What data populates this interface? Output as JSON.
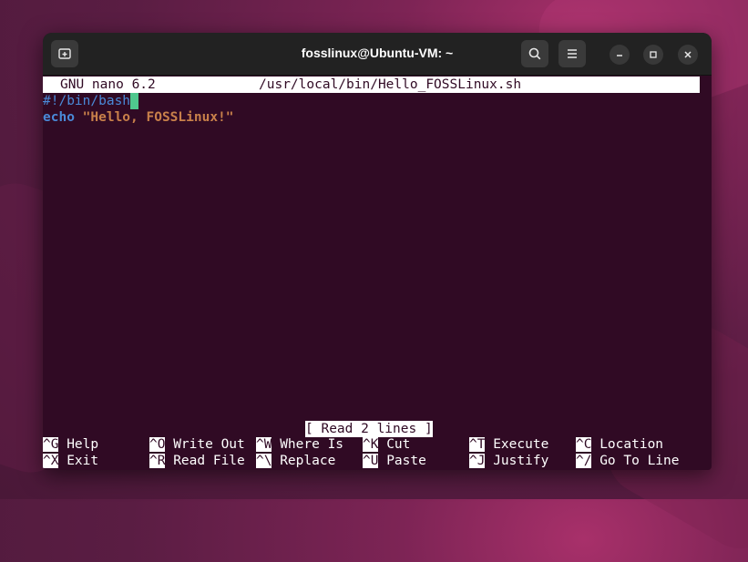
{
  "window": {
    "title": "fosslinux@Ubuntu-VM: ~",
    "buttons": {
      "new_tab_icon": "new-tab-icon",
      "search_icon": "search-icon",
      "menu_icon": "hamburger-menu-icon",
      "minimize_icon": "minimize-icon",
      "maximize_icon": "maximize-icon",
      "close_icon": "close-icon"
    }
  },
  "nano": {
    "version": "GNU nano 6.2",
    "filename": "/usr/local/bin/Hello_FOSSLinux.sh",
    "lines": {
      "shebang": "#!/bin/bash",
      "echo_keyword": "echo",
      "echo_string": "\"Hello, FOSSLinux!\""
    },
    "status": "[ Read 2 lines ]",
    "shortcuts_row1": [
      {
        "key": "^G",
        "label": "Help"
      },
      {
        "key": "^O",
        "label": "Write Out"
      },
      {
        "key": "^W",
        "label": "Where Is"
      },
      {
        "key": "^K",
        "label": "Cut"
      },
      {
        "key": "^T",
        "label": "Execute"
      },
      {
        "key": "^C",
        "label": "Location"
      }
    ],
    "shortcuts_row2": [
      {
        "key": "^X",
        "label": "Exit"
      },
      {
        "key": "^R",
        "label": "Read File"
      },
      {
        "key": "^\\",
        "label": "Replace"
      },
      {
        "key": "^U",
        "label": "Paste"
      },
      {
        "key": "^J",
        "label": "Justify"
      },
      {
        "key": "^/",
        "label": "Go To Line"
      }
    ]
  },
  "colors": {
    "terminal_bg": "#300a24",
    "keyword": "#4a8ad8",
    "string": "#c8804a",
    "cursor": "#4fc88e"
  }
}
